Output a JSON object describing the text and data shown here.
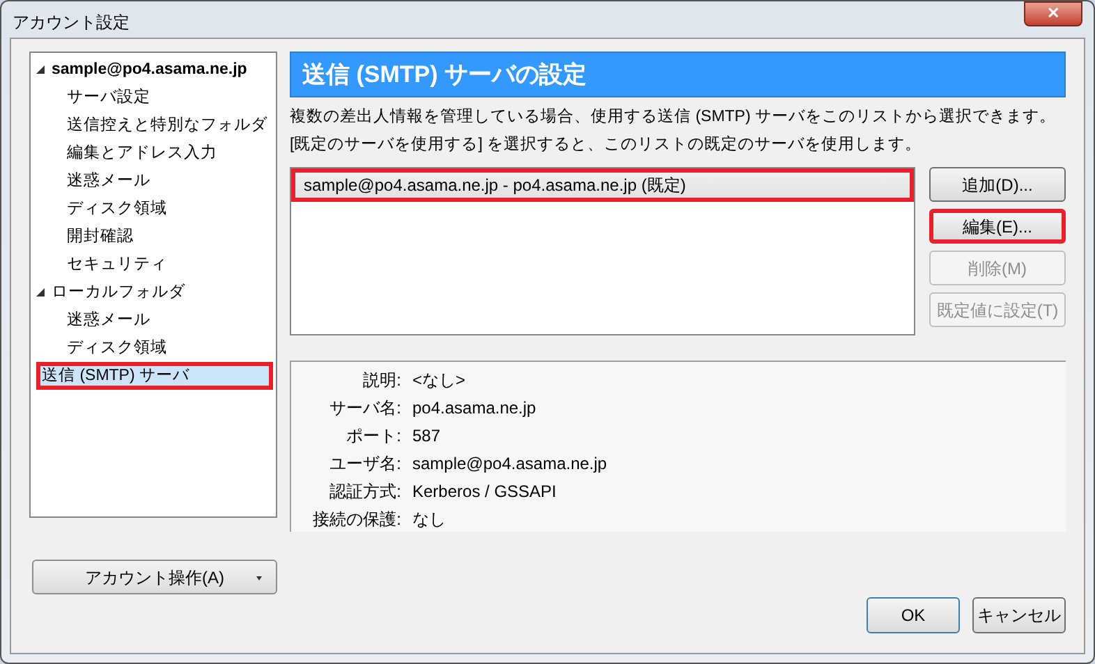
{
  "window": {
    "title": "アカウント設定",
    "close": "✕"
  },
  "tree": [
    {
      "label": "sample@po4.asama.ne.jp",
      "bold": true,
      "expanded": true,
      "selected": false,
      "highlighted": false,
      "children": [
        {
          "label": "サーバ設定",
          "selected": false,
          "highlighted": false
        },
        {
          "label": "送信控えと特別なフォルダ",
          "selected": false,
          "highlighted": false
        },
        {
          "label": "編集とアドレス入力",
          "selected": false,
          "highlighted": false
        },
        {
          "label": "迷惑メール",
          "selected": false,
          "highlighted": false
        },
        {
          "label": "ディスク領域",
          "selected": false,
          "highlighted": false
        },
        {
          "label": "開封確認",
          "selected": false,
          "highlighted": false
        },
        {
          "label": "セキュリティ",
          "selected": false,
          "highlighted": false
        }
      ]
    },
    {
      "label": "ローカルフォルダ",
      "bold": false,
      "expanded": true,
      "selected": false,
      "highlighted": false,
      "children": [
        {
          "label": "迷惑メール",
          "selected": false,
          "highlighted": false
        },
        {
          "label": "ディスク領域",
          "selected": false,
          "highlighted": false
        }
      ]
    },
    {
      "label": "送信 (SMTP) サーバ",
      "bold": false,
      "selected": true,
      "highlighted": true
    }
  ],
  "account_button": {
    "label": "アカウント操作(A)"
  },
  "panel": {
    "title": "送信 (SMTP) サーバの設定",
    "description": "複数の差出人情報を管理している場合、使用する送信 (SMTP) サーバをこのリストから選択できます。[既定のサーバを使用する] を選択すると、このリストの既定のサーバを使用します。",
    "servers": [
      {
        "label": "sample@po4.asama.ne.jp - po4.asama.ne.jp (既定)",
        "selected": true,
        "highlighted": true
      }
    ],
    "buttons": [
      {
        "label": "追加(D)...",
        "disabled": false,
        "highlighted": false
      },
      {
        "label": "編集(E)...",
        "disabled": false,
        "highlighted": true
      },
      {
        "label": "削除(M)",
        "disabled": true,
        "highlighted": false
      },
      {
        "label": "既定値に設定(T)",
        "disabled": true,
        "highlighted": false
      }
    ],
    "details": [
      {
        "label": "説明:",
        "value": "<なし>"
      },
      {
        "label": "サーバ名:",
        "value": "po4.asama.ne.jp"
      },
      {
        "label": "ポート:",
        "value": "587"
      },
      {
        "label": "ユーザ名:",
        "value": "sample@po4.asama.ne.jp"
      },
      {
        "label": "認証方式:",
        "value": "Kerberos / GSSAPI"
      },
      {
        "label": "接続の保護:",
        "value": "なし"
      }
    ]
  },
  "footer_buttons": [
    {
      "label": "OK",
      "default": true
    },
    {
      "label": "キャンセル",
      "default": false
    }
  ]
}
